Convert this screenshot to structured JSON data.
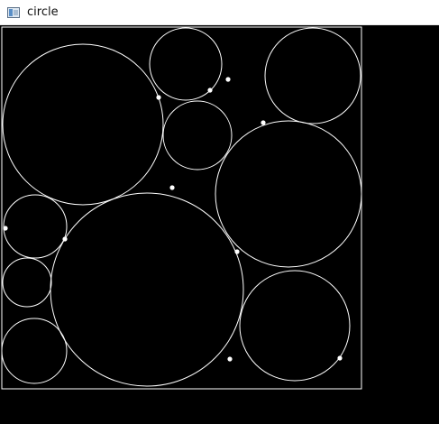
{
  "window": {
    "title": "circle"
  },
  "icons": {
    "app": "app-window-icon"
  },
  "colors": {
    "canvas": "#000000",
    "stroke": "#ffffff",
    "point": "#ffffff",
    "titlebar": "#ffffff"
  }
}
